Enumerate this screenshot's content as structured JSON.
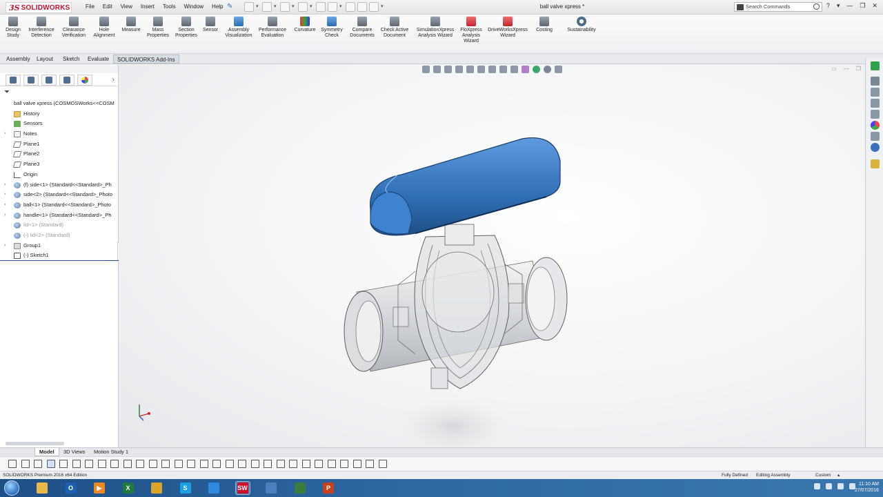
{
  "app": {
    "logo": {
      "ds": "3S",
      "name": "SOLIDWORKS"
    },
    "menus": [
      "File",
      "Edit",
      "View",
      "Insert",
      "Tools",
      "Window",
      "Help"
    ],
    "document_title": "ball valve xpress *",
    "search_placeholder": "Search Commands"
  },
  "command_manager": [
    {
      "label": "Design Study",
      "icon": "design-study-icon"
    },
    {
      "label": "Interference Detection",
      "icon": "interference-detection-icon"
    },
    {
      "label": "Clearance Verification",
      "icon": "clearance-verification-icon"
    },
    {
      "label": "Hole Alignment",
      "icon": "hole-alignment-icon"
    },
    {
      "label": "Measure",
      "icon": "measure-icon"
    },
    {
      "label": "Mass Properties",
      "icon": "mass-properties-icon"
    },
    {
      "label": "Section Properties",
      "icon": "section-properties-icon"
    },
    {
      "label": "Sensor",
      "icon": "sensor-icon"
    },
    {
      "label": "Assembly Visualization",
      "icon": "assembly-visualization-icon"
    },
    {
      "label": "Performance Evaluation",
      "icon": "performance-evaluation-icon"
    },
    {
      "label": "Curvature",
      "icon": "curvature-icon"
    },
    {
      "label": "Symmetry Check",
      "icon": "symmetry-check-icon"
    },
    {
      "label": "Compare Documents",
      "icon": "compare-documents-icon"
    },
    {
      "label": "Check Active Document",
      "icon": "check-active-document-icon"
    },
    {
      "label": "SimulationXpress Analysis Wizard",
      "icon": "simulationxpress-icon"
    },
    {
      "label": "FloXpress Analysis Wizard",
      "icon": "floxpress-icon"
    },
    {
      "label": "DriveWorksXpress Wizard",
      "icon": "driveworksxpress-icon"
    },
    {
      "label": "Costing",
      "icon": "costing-icon"
    },
    {
      "label": "Sustainability",
      "icon": "sustainability-icon"
    }
  ],
  "tabs": [
    "Assembly",
    "Layout",
    "Sketch",
    "Evaluate",
    "SOLIDWORKS Add-Ins"
  ],
  "active_tab": "SOLIDWORKS Add-Ins",
  "feature_tree": [
    {
      "label": "ball valve xpress  (COSMOSWorks<<COSM",
      "icon": "assembly",
      "expander": "",
      "indent": 0
    },
    {
      "label": "History",
      "icon": "folder",
      "expander": "",
      "indent": 1
    },
    {
      "label": "Sensors",
      "icon": "sensor",
      "expander": "",
      "indent": 1
    },
    {
      "label": "Notes",
      "icon": "note",
      "expander": "›",
      "indent": 1
    },
    {
      "label": "Plane1",
      "icon": "plane",
      "expander": "",
      "indent": 1
    },
    {
      "label": "Plane2",
      "icon": "plane",
      "expander": "",
      "indent": 1
    },
    {
      "label": "Plane3",
      "icon": "plane",
      "expander": "",
      "indent": 1
    },
    {
      "label": "Origin",
      "icon": "origin",
      "expander": "",
      "indent": 1
    },
    {
      "label": "(f) side<1> (Standard<<Standard>_Ph",
      "icon": "part",
      "expander": "›",
      "indent": 1
    },
    {
      "label": "side<2> (Standard<<Standard>_Photo",
      "icon": "part",
      "expander": "›",
      "indent": 1
    },
    {
      "label": "ball<1> (Standard<<Standard>_Photo",
      "icon": "part",
      "expander": "›",
      "indent": 1
    },
    {
      "label": "handle<1> (Standard<<Standard>_Ph",
      "icon": "part",
      "expander": "›",
      "indent": 1
    },
    {
      "label": "lid<1> (Standard)",
      "icon": "part",
      "expander": "",
      "indent": 1,
      "muted": true
    },
    {
      "label": "(-) lid<2> (Standard)",
      "icon": "part",
      "expander": "",
      "indent": 1,
      "muted": true
    },
    {
      "label": "Group1",
      "icon": "group",
      "expander": "›",
      "indent": 1
    },
    {
      "label": "(-) Sketch1",
      "icon": "sketch",
      "expander": "",
      "indent": 1,
      "selected": true
    }
  ],
  "model_tabs": [
    "Model",
    "3D Views",
    "Motion Study 1"
  ],
  "status": {
    "product": "SOLIDWORKS Premium 2016 x64 Edition",
    "defined": "Fully Defined",
    "mode": "Editing Assembly",
    "units": "Custom"
  },
  "taskbar": {
    "apps": [
      {
        "name": "explorer",
        "glyph": "",
        "color": "#e8b84a"
      },
      {
        "name": "outlook",
        "glyph": "O",
        "color": "#1c5fb0"
      },
      {
        "name": "media-player",
        "glyph": "▶",
        "color": "#e98b23"
      },
      {
        "name": "excel",
        "glyph": "X",
        "color": "#1f7a3c"
      },
      {
        "name": "chrome",
        "glyph": "",
        "color": "#d9a62a"
      },
      {
        "name": "skype",
        "glyph": "S",
        "color": "#1aa0e0"
      },
      {
        "name": "camera",
        "glyph": "",
        "color": "#2b8ae0"
      },
      {
        "name": "solidworks",
        "glyph": "SW",
        "color": "#c8102e"
      },
      {
        "name": "settings",
        "glyph": "",
        "color": "#4a80c0"
      },
      {
        "name": "monitor",
        "glyph": "",
        "color": "#3a7a3a"
      },
      {
        "name": "powerpoint",
        "glyph": "P",
        "color": "#c5401f"
      }
    ],
    "time": "11:10 AM",
    "date": "27/07/2016"
  },
  "colors": {
    "handle": "#2f6fb5",
    "accent": "#c8102e",
    "taskbar": "#2f6aa4"
  }
}
